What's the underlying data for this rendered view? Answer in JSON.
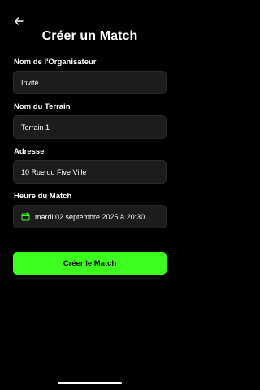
{
  "header": {
    "title": "Créer un Match"
  },
  "form": {
    "organizer": {
      "label": "Nom de l'Organisateur",
      "value": "Invité"
    },
    "field_name": {
      "label": "Nom du Terrain",
      "value": "Terrain 1"
    },
    "address": {
      "label": "Adresse",
      "value": "10 Rue du Five Ville"
    },
    "match_time": {
      "label": "Heure du Match",
      "value": "mardi 02 septembre 2025 à 20:30",
      "icon": "calendar-icon"
    }
  },
  "actions": {
    "create_label": "Créer le Match"
  },
  "colors": {
    "accent": "#3dff1f",
    "field_bg": "#1c1c1e",
    "background": "#000000"
  }
}
